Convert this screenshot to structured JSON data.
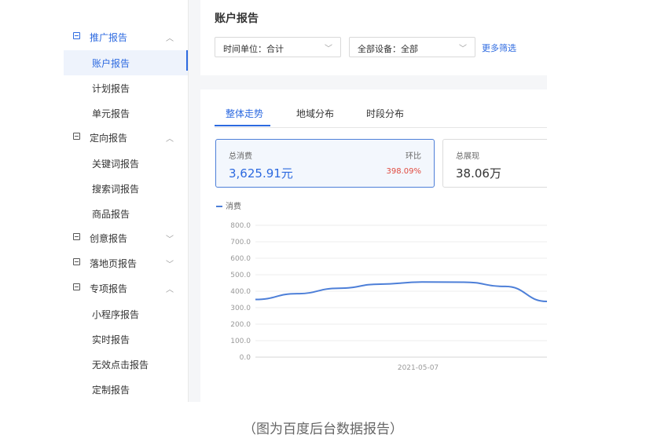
{
  "sidebar": {
    "groups": [
      {
        "label": "推广报告",
        "expanded": true,
        "active": true,
        "items": [
          {
            "label": "账户报告",
            "active": true
          },
          {
            "label": "计划报告"
          },
          {
            "label": "单元报告"
          }
        ]
      },
      {
        "label": "定向报告",
        "expanded": true,
        "items": [
          {
            "label": "关键词报告"
          },
          {
            "label": "搜索词报告"
          },
          {
            "label": "商品报告"
          }
        ]
      },
      {
        "label": "创意报告",
        "expanded": false,
        "items": []
      },
      {
        "label": "落地页报告",
        "expanded": false,
        "items": []
      },
      {
        "label": "专项报告",
        "expanded": true,
        "items": [
          {
            "label": "小程序报告"
          },
          {
            "label": "实时报告"
          },
          {
            "label": "无效点击报告"
          },
          {
            "label": "定制报告"
          }
        ]
      }
    ]
  },
  "header": {
    "title": "账户报告",
    "time_unit": "时间单位：合计",
    "device": "全部设备：全部",
    "more_filter": "更多筛选"
  },
  "tabs": [
    {
      "label": "整体走势",
      "active": true
    },
    {
      "label": "地域分布"
    },
    {
      "label": "时段分布"
    }
  ],
  "cards": {
    "spend": {
      "label": "总消费",
      "value": "3,625.91元",
      "change_label": "环比",
      "change_value": "398.09%"
    },
    "impressions": {
      "label": "总展现",
      "value": "38.06万"
    }
  },
  "legend": {
    "series": "消费"
  },
  "chart_data": {
    "type": "line",
    "x": [
      "2021-05-07"
    ],
    "yticks": [
      "800.0",
      "700.0",
      "600.0",
      "500.0",
      "400.0",
      "300.0",
      "200.0",
      "100.0",
      "0.0"
    ],
    "ylim": [
      0,
      800
    ],
    "grid": true,
    "series": [
      {
        "name": "消费",
        "color": "#4d7fd8",
        "curve": [
          350,
          385,
          418,
          443,
          456,
          455,
          429,
          338
        ]
      }
    ]
  },
  "caption": "（图为百度后台数据报告）",
  "colors": {
    "accent": "#2d6ae0",
    "negative": "#e04a3f"
  }
}
